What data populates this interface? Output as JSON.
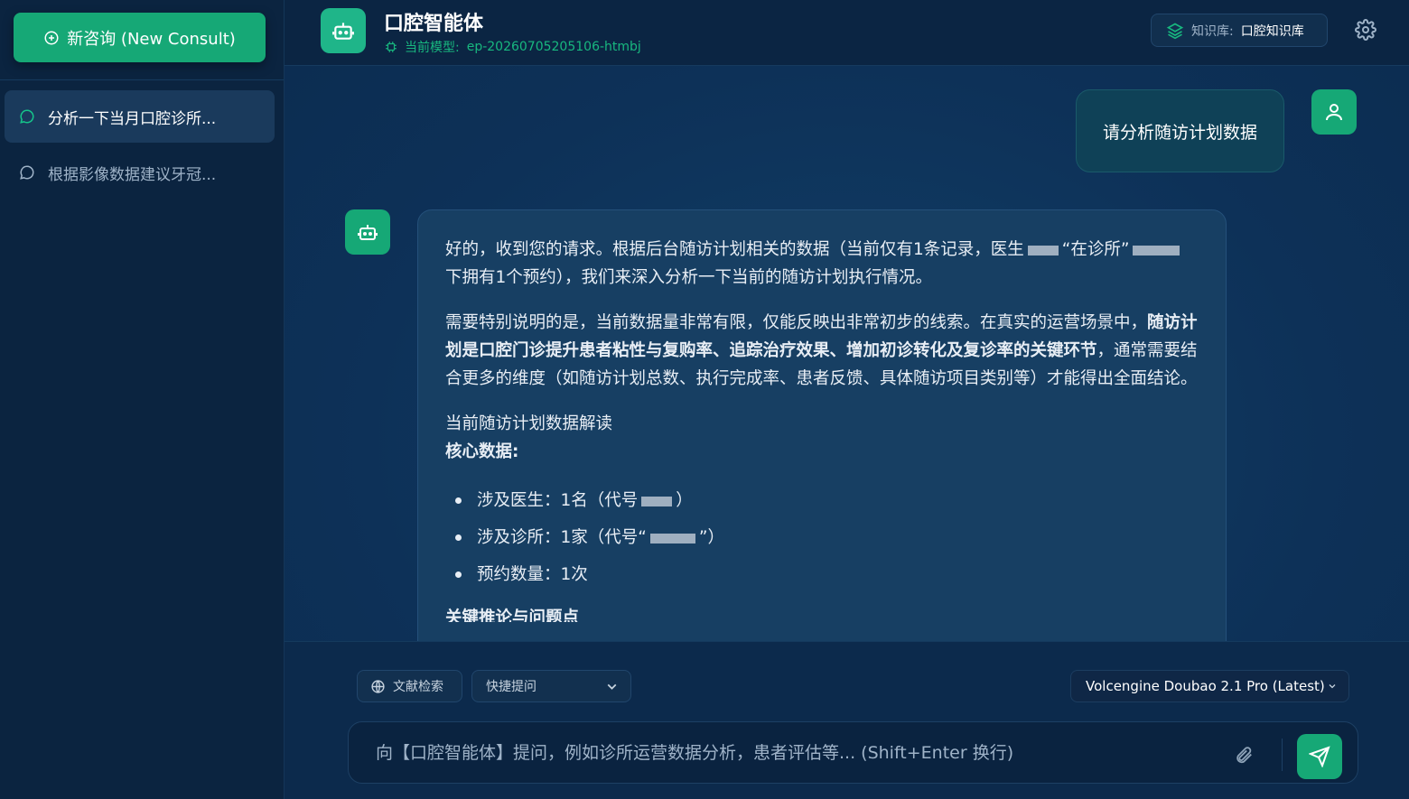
{
  "sidebar": {
    "new_consult_label": "新咨询 (New Consult)",
    "conversations": [
      {
        "label": "分析一下当月口腔诊所...",
        "active": true
      },
      {
        "label": "根据影像数据建议牙冠...",
        "active": false
      }
    ]
  },
  "header": {
    "title": "口腔智能体",
    "model_prefix": "当前模型:",
    "model_id": "ep-20260705205106-htmbj",
    "kb_label": "知识库:",
    "kb_value": "口腔知识库"
  },
  "chat": {
    "user_message": "请分析随访计划数据",
    "bot": {
      "p1_a": "好的，收到您的请求。根据后台随访计划相关的数据（当前仅有1条记录，医生",
      "p1_b": "在诊所",
      "p1_c": "下拥有1个预约），我们来深入分析一下当前的随访计划执行情况。",
      "p2_a": "需要特别说明的是，当前数据量非常有限，仅能反映出非常初步的线索。在真实的运营场景中，",
      "p2_bold": "随访计划是口腔门诊提升患者粘性与复购率、追踪治疗效果、增加初诊转化及复诊率的关键环节",
      "p2_b": "，通常需要结合更多的维度（如随访计划总数、执行完成率、患者反馈、具体随访项目类别等）才能得出全面结论。",
      "section_title": "当前随访计划数据解读",
      "core_label": "核心数据:",
      "bullets": [
        "涉及医生：1名（代号",
        "涉及诊所：1家（代号",
        "预约数量：1次"
      ],
      "cutoff": "关键推论与问题点"
    }
  },
  "composer": {
    "lit_search_label": "文献检索",
    "quick_label": "快捷提问",
    "model_select": "Volcengine Doubao 2.1 Pro (Latest)",
    "input_placeholder": "向【口腔智能体】提问，例如诊所运营数据分析，患者评估等... (Shift+Enter 换行)",
    "input_value": ""
  },
  "colors": {
    "accent": "#16a876",
    "sidebar_bg": "#0b2440",
    "main_bg": "#0d3158",
    "bubble_bg": "#173f63"
  }
}
